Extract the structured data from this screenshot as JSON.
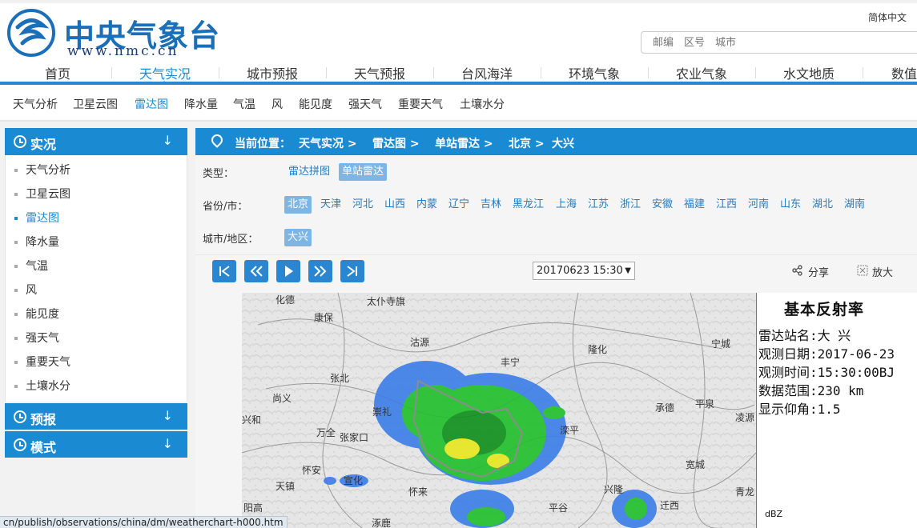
{
  "site": {
    "title": "中央气象台",
    "url": "www.nmc.cn",
    "lang": "简体中文",
    "search_placeholder": "邮编　区号　城市"
  },
  "main_nav": [
    "首页",
    "天气实况",
    "城市预报",
    "天气预报",
    "台风海洋",
    "环境气象",
    "农业气象",
    "水文地质",
    "数值"
  ],
  "main_nav_active": 1,
  "sub_nav": [
    "天气分析",
    "卫星云图",
    "雷达图",
    "降水量",
    "气温",
    "风",
    "能见度",
    "强天气",
    "重要天气",
    "土壤水分"
  ],
  "sub_nav_active": 2,
  "sidebar": {
    "sections": [
      {
        "label": "实况",
        "arrow": "↓"
      },
      {
        "label": "预报",
        "arrow": "↓"
      },
      {
        "label": "模式",
        "arrow": "↓"
      }
    ],
    "items": [
      "天气分析",
      "卫星云图",
      "雷达图",
      "降水量",
      "气温",
      "风",
      "能见度",
      "强天气",
      "重要天气",
      "土壤水分"
    ],
    "active_item": 2
  },
  "breadcrumb": [
    "当前位置：",
    "天气实况 >",
    "雷达图 >",
    "单站雷达 >",
    "北京 >",
    "大兴"
  ],
  "filters": {
    "type_label": "类型：",
    "types": [
      "雷达拼图",
      "单站雷达"
    ],
    "province_label": "省份/市：",
    "provinces": [
      "北京",
      "天津",
      "河北",
      "山西",
      "内蒙",
      "辽宁",
      "吉林",
      "黑龙江",
      "上海",
      "江苏",
      "浙江",
      "安徽",
      "福建",
      "江西",
      "河南",
      "山东",
      "湖北",
      "湖南"
    ],
    "city_label": "城市/地区：",
    "cities": [
      "大兴"
    ]
  },
  "toolbar": {
    "datetime": "20170623 15:30",
    "share": "分享",
    "zoom": "放大"
  },
  "map": {
    "place_labels": [
      "化德",
      "太仆寺旗",
      "康保",
      "沽源",
      "丰宁",
      "隆化",
      "宁城",
      "张北",
      "尚义",
      "崇礼",
      "承德",
      "平泉",
      "凌源",
      "兴和",
      "万全",
      "张家口",
      "滦平",
      "宽城",
      "怀安",
      "宣化",
      "天镇",
      "怀来",
      "兴隆",
      "青龙",
      "迁西",
      "阳高",
      "涿鹿",
      "平谷"
    ]
  },
  "legend": {
    "title": "基本反射率",
    "lines": [
      "雷达站名:大 兴",
      "观测日期:2017-06-23",
      "观测时间:15:30:00BJ",
      "数据范围:230 km",
      "显示仰角:1.5"
    ],
    "unit": "dBZ"
  },
  "status_url": "cn/publish/observations/china/dm/weatherchart-h000.htm",
  "colors": {
    "accent": "#1a8ad3",
    "chip_active": "#7fb5e3"
  }
}
